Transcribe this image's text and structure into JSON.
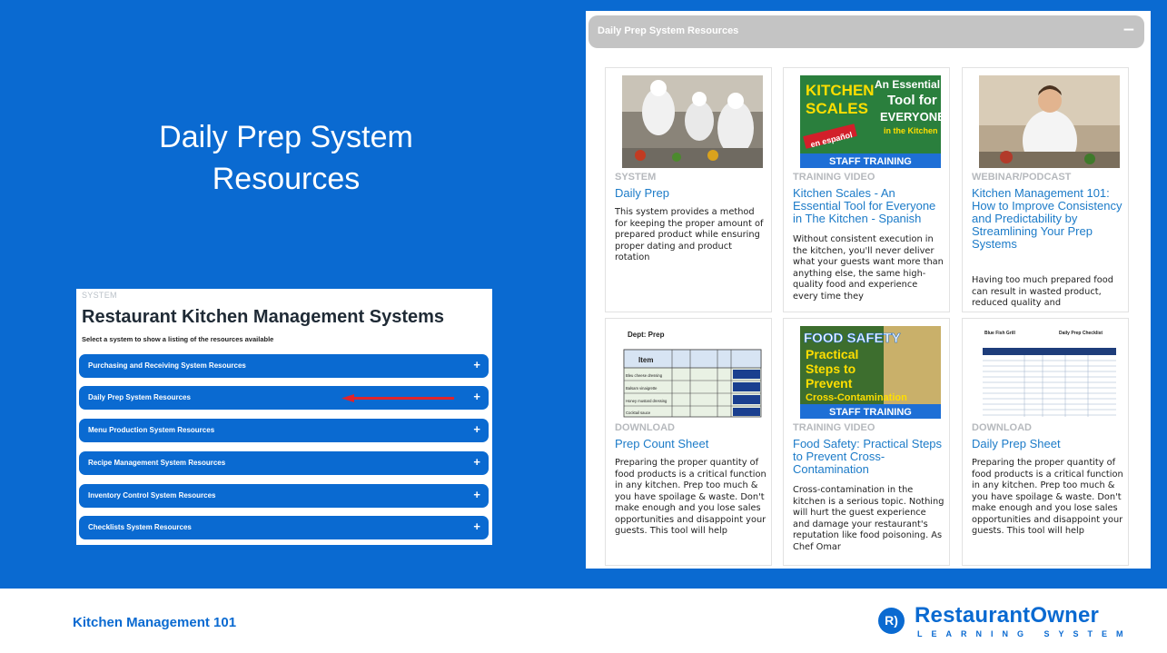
{
  "slide": {
    "title_line1": "Daily Prep System",
    "title_line2": "Resources",
    "footer": "Kitchen Management 101",
    "bg_color": "#0a6ad1"
  },
  "systems": {
    "kicker": "SYSTEM",
    "title": "Restaurant Kitchen Management Systems",
    "subtitle": "Select a system to show a listing of the resources available",
    "items": [
      {
        "label": "Purchasing and Receiving System Resources",
        "icon": "plus-icon"
      },
      {
        "label": "Daily Prep System Resources",
        "icon": "plus-icon"
      },
      {
        "label": "Menu Production System Resources",
        "icon": "plus-icon"
      },
      {
        "label": "Recipe Management System Resources",
        "icon": "plus-icon"
      },
      {
        "label": "Inventory Control System Resources",
        "icon": "plus-icon"
      },
      {
        "label": "Checklists System Resources",
        "icon": "plus-icon"
      }
    ],
    "plus": "+"
  },
  "resources": {
    "header": "Daily Prep System Resources",
    "collapse": "−",
    "cards": [
      {
        "kind": "SYSTEM",
        "title": "Daily Prep",
        "desc": "This system provides a method for keeping the proper amount of prepared product while ensuring proper dating and product rotation"
      },
      {
        "kind": "TRAINING VIDEO",
        "title": "Kitchen Scales - An Essential Tool for Everyone in The Kitchen - Spanish",
        "desc": "Without consistent execution in the kitchen, you'll never deliver what your guests want more than anything else, the same high-quality food and experience every time they"
      },
      {
        "kind": "WEBINAR/PODCAST",
        "title": "Kitchen Management 101: How to Improve Consistency and Predictability by Streamlining Your Prep Systems",
        "desc": "Having too much prepared food can result in wasted product, reduced quality and"
      },
      {
        "kind": "DOWNLOAD",
        "title": "Prep Count Sheet",
        "desc": "Preparing the proper quantity of food products is a critical function in any kitchen. Prep too much & you have spoilage & waste. Don't make enough and you lose sales opportunities and disappoint your guests. This tool will help"
      },
      {
        "kind": "TRAINING VIDEO",
        "title": "Food Safety: Practical Steps to Prevent Cross-Contamination",
        "desc": "Cross-contamination in the kitchen is a serious topic. Nothing will hurt the guest experience and damage your restaurant's reputation like food poisoning. As Chef Omar"
      },
      {
        "kind": "DOWNLOAD",
        "title": "Daily Prep Sheet",
        "desc": "Preparing the proper quantity of food products is a critical function in any kitchen. Prep too much & you have spoilage & waste. Don't make enough and you lose sales opportunities and disappoint your guests. This tool will help"
      }
    ],
    "thumbs": {
      "scales_line1": "KITCHEN",
      "scales_line2": "SCALES",
      "scales_an": "An Essential",
      "scales_tool": "Tool for",
      "scales_everyone": "EVERYONE",
      "scales_kitchen": "in the Kitchen",
      "scales_espanol": "en español",
      "staff_training": "STAFF TRAINING",
      "prep_dept": "Dept: Prep",
      "prep_item": "Item",
      "prep_rows": [
        "Bleu cheese dressing",
        "Balsam vinaigrette",
        "Honey mustard dressing",
        "Cocktail sauce"
      ],
      "fs_title": "FOOD SAFETY",
      "fs_l1": "Practical",
      "fs_l2": "Steps to",
      "fs_l3": "Prevent",
      "fs_l4": "Cross-Contamination",
      "dps_brand": "Blue Fish Grill",
      "dps_title": "Daily Prep Checklist"
    }
  },
  "logo": {
    "mark": "R)",
    "name": "RestaurantOwner",
    "tag": "LEARNING SYSTEM"
  }
}
